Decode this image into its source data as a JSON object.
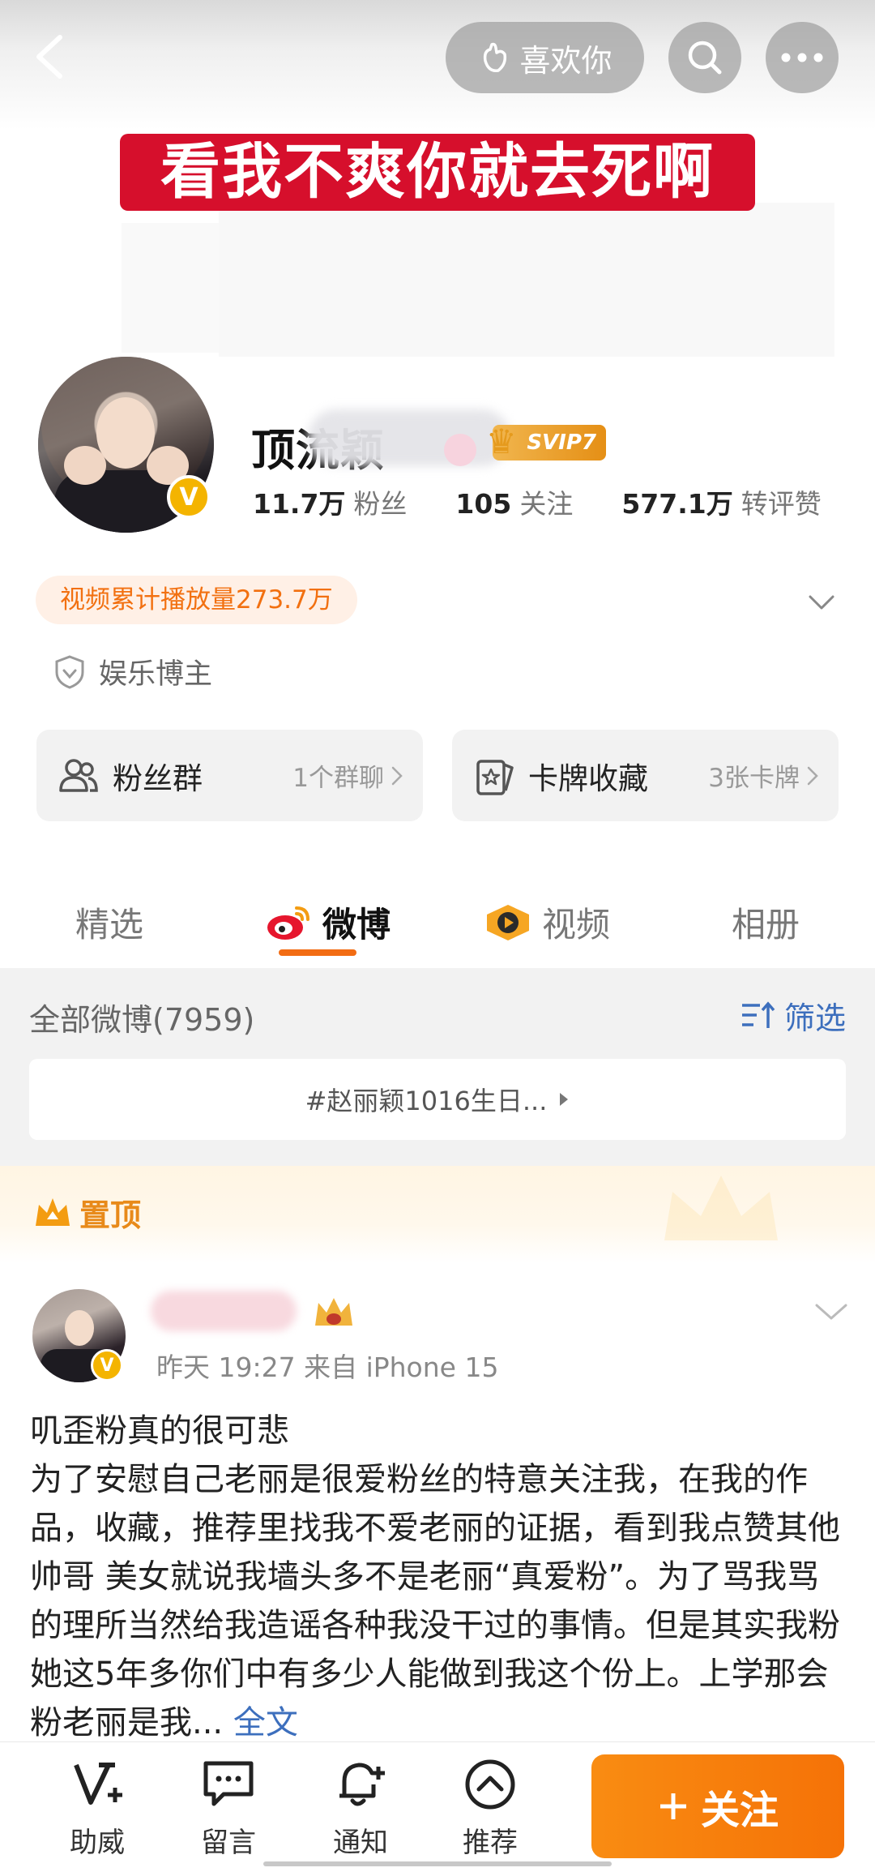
{
  "header": {
    "like_label": "喜欢你"
  },
  "banner": {
    "slogan": "看我不爽你就去死啊"
  },
  "profile": {
    "name_visible": "顶流颖",
    "svip_label": "SVIP7",
    "stats": [
      {
        "value": "11.7万",
        "label": "粉丝"
      },
      {
        "value": "105",
        "label": "关注"
      },
      {
        "value": "577.1万",
        "label": "转评赞"
      }
    ],
    "play_count": "视频累计播放量273.7万",
    "certification": "娱乐博主",
    "cards": [
      {
        "title": "粉丝群",
        "sub": "1个群聊"
      },
      {
        "title": "卡牌收藏",
        "sub": "3张卡牌"
      }
    ]
  },
  "tabs": [
    {
      "label": "精选",
      "active": false
    },
    {
      "label": "微博",
      "active": true
    },
    {
      "label": "视频",
      "active": false
    },
    {
      "label": "相册",
      "active": false
    }
  ],
  "feed": {
    "all_label": "全部微博(7959)",
    "filter_label": "筛选",
    "topic": "#赵丽颖1016生日...",
    "pinned_label": "置顶"
  },
  "post": {
    "meta": "昨天 19:27   来自 iPhone 15",
    "title_line": "叽歪粉真的很可悲",
    "body": "为了安慰自己老丽是很爱粉丝的特意关注我，在我的作品，收藏，推荐里找我不爱老丽的证据，看到我点赞其他帅哥 美女就说我墙头多不是老丽“真爱粉”。为了骂我骂的理所当然给我造谣各种我没干过的事情。但是其实我粉她这5年多你们中有多少人能做到我这个份上。上学那会粉老丽是我...",
    "full_text": "全文"
  },
  "bottom_bar": {
    "items": [
      "助威",
      "留言",
      "通知",
      "推荐"
    ],
    "follow_label": "关注"
  },
  "colors": {
    "accent_orange": "#f57207",
    "link_blue": "#3d6fbd",
    "slogan_red": "#d60f2c",
    "verified_gold": "#f4b400"
  }
}
